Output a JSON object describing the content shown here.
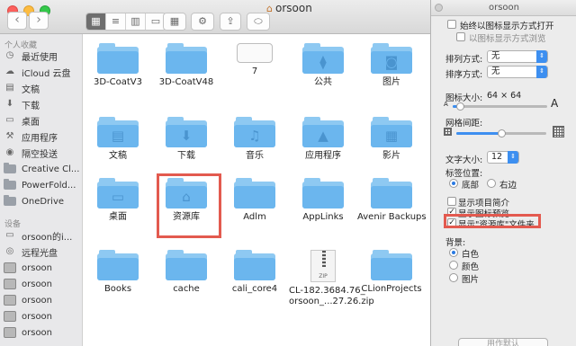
{
  "window": {
    "title": "orsoon"
  },
  "toolbar": {
    "view_icons": [
      "icon-view",
      "list-view",
      "column-view",
      "cover-flow-view"
    ],
    "arrange_label": "▦",
    "action_label": "⚙",
    "share_label": "⇪",
    "tag_label": "⬭"
  },
  "sidebar": {
    "favorites_header": "个人收藏",
    "favorites": [
      {
        "label": "最近使用",
        "icon": "clock-icon"
      },
      {
        "label": "iCloud 云盘",
        "icon": "cloud-icon"
      },
      {
        "label": "文稿",
        "icon": "document-icon"
      },
      {
        "label": "下载",
        "icon": "download-icon"
      },
      {
        "label": "桌面",
        "icon": "desktop-icon"
      },
      {
        "label": "应用程序",
        "icon": "applications-icon"
      },
      {
        "label": "隔空投送",
        "icon": "airdrop-icon"
      },
      {
        "label": "Creative Cl...",
        "icon": "folder-icon"
      },
      {
        "label": "PowerFold...",
        "icon": "folder-icon"
      },
      {
        "label": "OneDrive",
        "icon": "folder-icon"
      }
    ],
    "devices_header": "设备",
    "devices": [
      {
        "label": "orsoon的i...",
        "icon": "computer-icon"
      },
      {
        "label": "远程光盘",
        "icon": "disc-icon"
      },
      {
        "label": "orsoon",
        "icon": "disk-icon"
      },
      {
        "label": "orsoon",
        "icon": "disk-icon"
      },
      {
        "label": "orsoon",
        "icon": "disk-icon"
      },
      {
        "label": "orsoon",
        "icon": "disk-icon"
      },
      {
        "label": "orsoon",
        "icon": "disk-icon"
      }
    ]
  },
  "files": [
    {
      "label": "3D-CoatV3",
      "kind": "folder",
      "glyph": ""
    },
    {
      "label": "3D-CoatV48",
      "kind": "folder",
      "glyph": ""
    },
    {
      "label": "7",
      "kind": "blank",
      "glyph": ""
    },
    {
      "label": "公共",
      "kind": "folder",
      "glyph": "⧫"
    },
    {
      "label": "图片",
      "kind": "folder",
      "glyph": "◙"
    },
    {
      "label": "文稿",
      "kind": "folder",
      "glyph": "▤"
    },
    {
      "label": "下载",
      "kind": "folder",
      "glyph": "⬇"
    },
    {
      "label": "音乐",
      "kind": "folder",
      "glyph": "♫"
    },
    {
      "label": "应用程序",
      "kind": "folder",
      "glyph": "▲"
    },
    {
      "label": "影片",
      "kind": "folder",
      "glyph": "▦"
    },
    {
      "label": "桌面",
      "kind": "folder",
      "glyph": "▭"
    },
    {
      "label": "资源库",
      "kind": "folder",
      "glyph": "⌂"
    },
    {
      "label": "Adlm",
      "kind": "folder",
      "glyph": ""
    },
    {
      "label": "AppLinks",
      "kind": "folder",
      "glyph": ""
    },
    {
      "label": "Avenir Backups",
      "kind": "folder",
      "glyph": ""
    },
    {
      "label": "Books",
      "kind": "folder",
      "glyph": ""
    },
    {
      "label": "cache",
      "kind": "folder",
      "glyph": ""
    },
    {
      "label": "cali_core4",
      "kind": "folder",
      "glyph": ""
    },
    {
      "label": "CL-182.3684.76_\norsoon_...27.26.zip",
      "kind": "zip",
      "glyph": "ZIP"
    },
    {
      "label": "CLionProjects",
      "kind": "folder",
      "glyph": ""
    }
  ],
  "panel": {
    "title": "orsoon",
    "always_open_icon_view": "始终以图标显示方式打开",
    "browse_icon_view": "以图标显示方式浏览",
    "arrange_by_label": "排列方式:",
    "arrange_by_value": "无",
    "sort_by_label": "排序方式:",
    "sort_by_value": "无",
    "icon_size_label": "图标大小:",
    "icon_size_value": "64 × 64",
    "icon_size_small_glyph": "A",
    "icon_size_large_glyph": "A",
    "icon_size_fraction": 0.08,
    "grid_spacing_label": "网格间距:",
    "grid_spacing_fraction": 0.5,
    "text_size_label": "文字大小:",
    "text_size_value": "12",
    "label_position_label": "标签位置:",
    "label_bottom": "底部",
    "label_right": "右边",
    "show_item_info": "显示项目简介",
    "show_icon_preview": "显示图标预览",
    "show_library_folder": "显示\"资源库\"文件夹",
    "background_label": "背景:",
    "bg_white": "白色",
    "bg_color": "颜色",
    "bg_picture": "图片",
    "use_defaults": "用作默认"
  },
  "colors": {
    "highlight": "#e35a4f",
    "accent": "#3d8ff0",
    "folder": "#6bb6ee"
  }
}
